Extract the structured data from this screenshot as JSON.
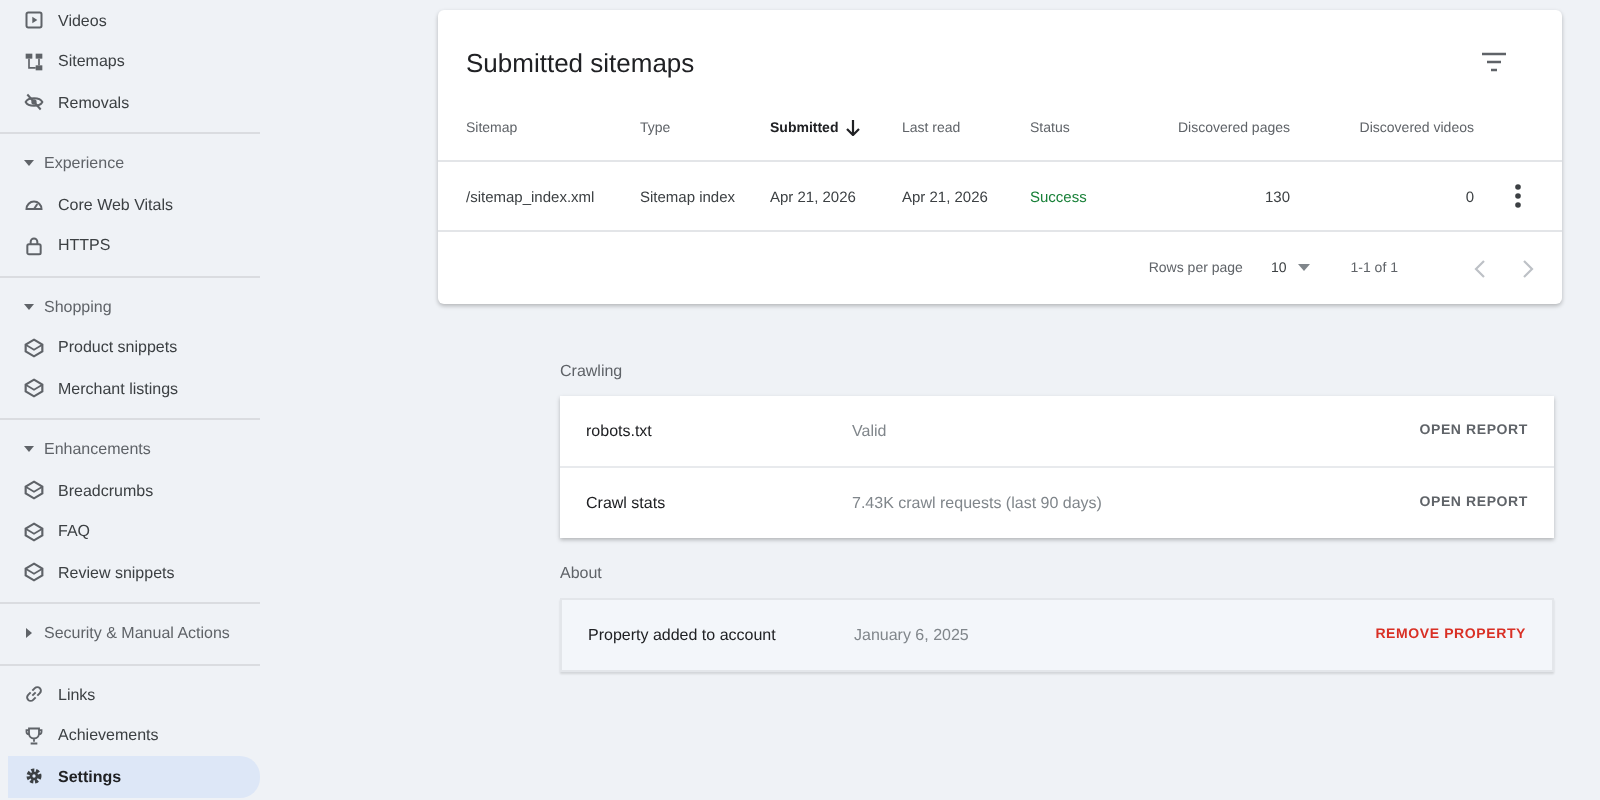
{
  "sidebar": {
    "sections": [
      {
        "items": [
          {
            "label": "Videos",
            "kind": "video",
            "selected": false
          },
          {
            "label": "Sitemaps",
            "kind": "sitemap",
            "selected": false
          },
          {
            "label": "Removals",
            "kind": "hidden",
            "selected": false
          }
        ]
      },
      {
        "heading": "Experience",
        "expanded": true,
        "items": [
          {
            "label": "Core Web Vitals",
            "kind": "gauge",
            "selected": false
          },
          {
            "label": "HTTPS",
            "kind": "lock",
            "selected": false
          }
        ]
      },
      {
        "heading": "Shopping",
        "expanded": true,
        "items": [
          {
            "label": "Product snippets",
            "kind": "diamond",
            "selected": false
          },
          {
            "label": "Merchant listings",
            "kind": "diamond",
            "selected": false
          }
        ]
      },
      {
        "heading": "Enhancements",
        "expanded": true,
        "items": [
          {
            "label": "Breadcrumbs",
            "kind": "diamond",
            "selected": false
          },
          {
            "label": "FAQ",
            "kind": "diamond",
            "selected": false
          },
          {
            "label": "Review snippets",
            "kind": "diamond",
            "selected": false
          }
        ]
      },
      {
        "heading": "Security & Manual Actions",
        "expanded": false
      },
      {
        "items": [
          {
            "label": "Links",
            "kind": "link",
            "selected": false
          },
          {
            "label": "Achievements",
            "kind": "trophy",
            "selected": false
          },
          {
            "label": "Settings",
            "kind": "gear",
            "selected": true
          }
        ]
      }
    ]
  },
  "sitemaps": {
    "title": "Submitted sitemaps",
    "columns": [
      {
        "label": "Sitemap",
        "kind": "text",
        "sorted": false
      },
      {
        "label": "Type",
        "kind": "text",
        "sorted": false
      },
      {
        "label": "Submitted",
        "kind": "text",
        "sorted": true
      },
      {
        "label": "Last read",
        "kind": "text",
        "sorted": false
      },
      {
        "label": "Status",
        "kind": "text",
        "sorted": false
      },
      {
        "label": "Discovered pages",
        "kind": "number",
        "sorted": false
      },
      {
        "label": "Discovered videos",
        "kind": "number",
        "sorted": false
      }
    ],
    "rows": [
      {
        "cells": [
          "/sitemap_index.xml",
          "Sitemap index",
          "Apr 21, 2026",
          "Apr 21, 2026",
          "Success",
          "130",
          "0"
        ]
      }
    ],
    "pagination": {
      "rows_label": "Rows per page",
      "rows_value": "10",
      "range": "1-1 of 1"
    }
  },
  "crawling": {
    "heading": "Crawling",
    "rows": [
      {
        "name": "robots.txt",
        "value": "Valid",
        "action": "OPEN REPORT"
      },
      {
        "name": "Crawl stats",
        "value": "7.43K crawl requests (last 90 days)",
        "action": "OPEN REPORT"
      }
    ]
  },
  "about": {
    "heading": "About",
    "rows": [
      {
        "name": "Property added to account",
        "value": "January 6, 2025",
        "action": "REMOVE PROPERTY"
      }
    ]
  }
}
